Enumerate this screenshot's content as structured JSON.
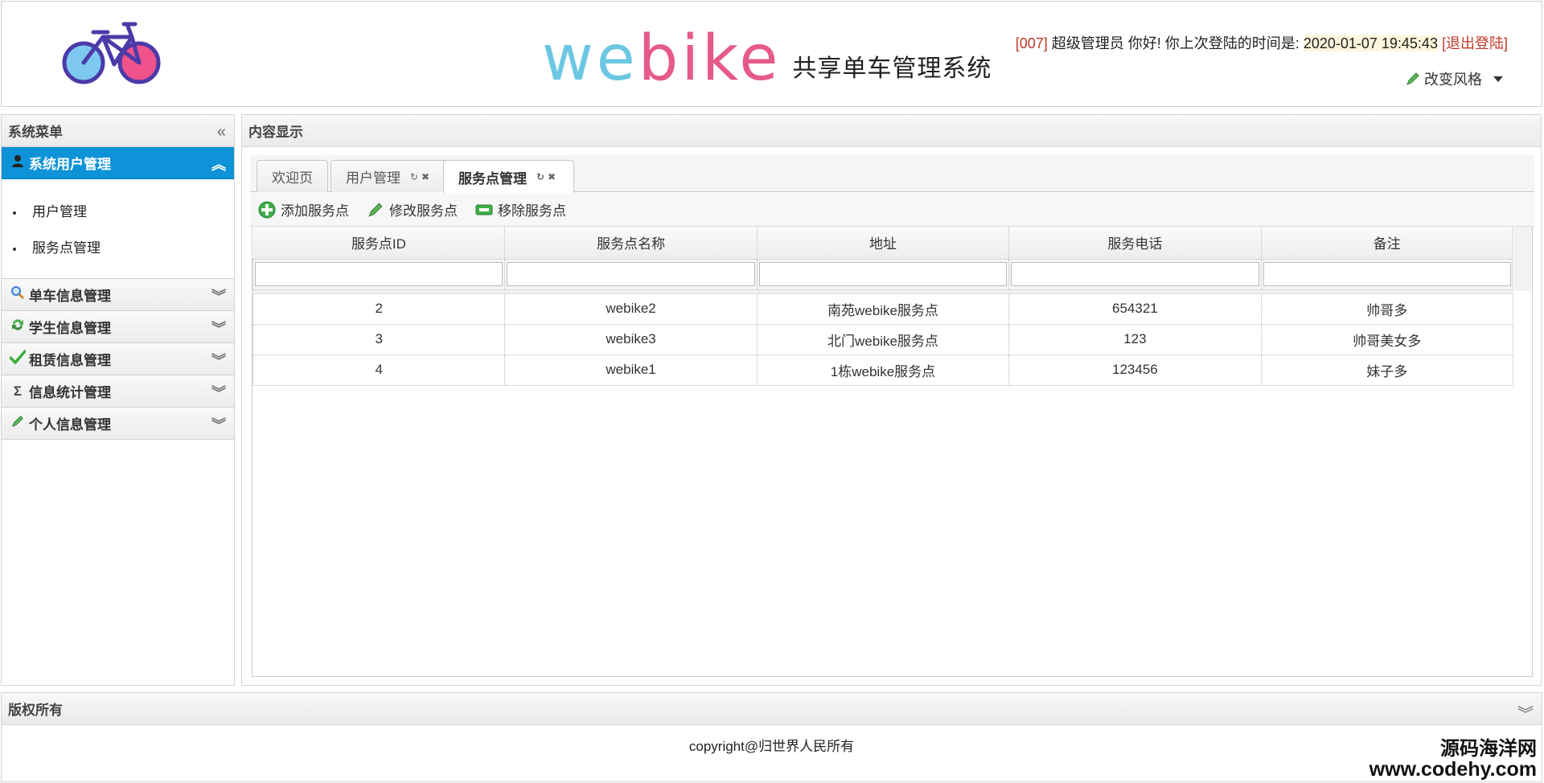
{
  "header": {
    "brand_word": "webike",
    "brand_sub": "共享单车管理系统",
    "user_id": "[007]",
    "user_greeting": "超级管理员 你好! 你上次登陆的时间是:",
    "last_login": "2020-01-07 19:45:43",
    "logout": "[退出登陆]",
    "theme_label": "改变风格"
  },
  "sidebar": {
    "title": "系统菜单",
    "active_section": "系统用户管理",
    "active_items": [
      "用户管理",
      "服务点管理"
    ],
    "sections": [
      "单车信息管理",
      "学生信息管理",
      "租赁信息管理",
      "信息统计管理",
      "个人信息管理"
    ]
  },
  "main": {
    "title": "内容显示",
    "tabs": [
      "欢迎页",
      "用户管理",
      "服务点管理"
    ],
    "toolbar": {
      "add": "添加服务点",
      "edit": "修改服务点",
      "remove": "移除服务点"
    },
    "columns": [
      "服务点ID",
      "服务点名称",
      "地址",
      "服务电话",
      "备注"
    ],
    "rows": [
      [
        "2",
        "webike2",
        "南苑webike服务点",
        "654321",
        "帅哥多"
      ],
      [
        "3",
        "webike3",
        "北门webike服务点",
        "123",
        "帅哥美女多"
      ],
      [
        "4",
        "webike1",
        "1栋webike服务点",
        "123456",
        "妹子多"
      ]
    ]
  },
  "footer": {
    "title": "版权所有",
    "copyright": "copyright@归世界人民所有",
    "watermark_top": "源码海洋网",
    "watermark_bottom": "www.codehy.com"
  },
  "colors": {
    "accent": "#0e93d8",
    "brand_blue": "#6cc7e3",
    "brand_pink": "#e65a8a"
  }
}
